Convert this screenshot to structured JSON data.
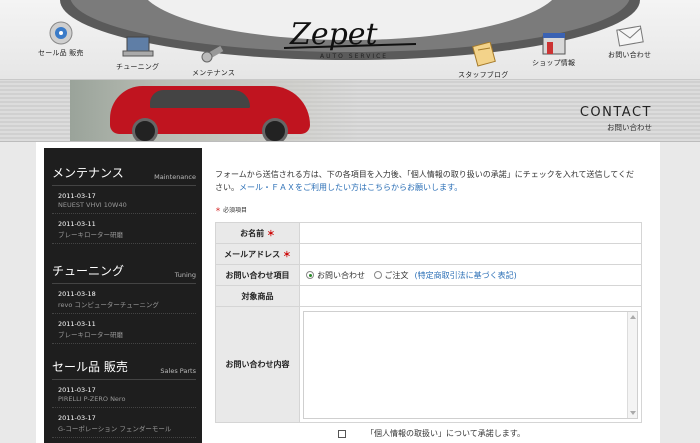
{
  "nav": {
    "sale": "セール品 販売",
    "tuning": "チューニング",
    "maintenance": "メンテナンス",
    "staff_blog": "スタッフブログ",
    "shop_info": "ショップ情報",
    "inquiry": "お問い合わせ"
  },
  "logo": {
    "text": "Zepet",
    "sub": "AUTO SERVICE"
  },
  "banner": {
    "title": "CONTACT",
    "subtitle": "お問い合わせ"
  },
  "sidebar": {
    "maintenance": {
      "title_jp": "メンテナンス",
      "title_en": "Maintenance",
      "posts": [
        {
          "date": "2011-03-17",
          "title": "NEUEST VHVI 10W40"
        },
        {
          "date": "2011-03-11",
          "title": "ブレーキローター研磨"
        }
      ]
    },
    "tuning": {
      "title_jp": "チューニング",
      "title_en": "Tuning",
      "posts": [
        {
          "date": "2011-03-18",
          "title": "revo コンピューターチューニング"
        },
        {
          "date": "2011-03-11",
          "title": "ブレーキローター研磨"
        }
      ]
    },
    "sales": {
      "title_jp": "セール品 販売",
      "title_en": "Sales Parts",
      "posts": [
        {
          "date": "2011-03-17",
          "title": "PIRELLI P-ZERO Nero"
        },
        {
          "date": "2011-03-17",
          "title": "G-コーポレーション フェンダーモール"
        }
      ]
    }
  },
  "content": {
    "intro": "フォームから送信される方は、下の各項目を入力後、「個人情報の取り扱いの承諾」にチェックを入れて送信してください。",
    "intro_link": "メール・ＦＡＸをご利用したい方はこちらからお願いします。",
    "required_star": "＊",
    "required_note": "必須項目"
  },
  "form": {
    "name_label": "お名前",
    "email_label": "メールアドレス",
    "type_label": "お問い合わせ項目",
    "type_options": [
      "お問い合わせ",
      "ご注文"
    ],
    "type_selected": "お問い合わせ",
    "type_note": "(特定商取引法に基づく表記)",
    "product_label": "対象商品",
    "message_label": "お問い合わせ内容",
    "star": "＊",
    "agree_text": "「個人情報の取扱い」について承諾します。"
  },
  "colors": {
    "accent_link": "#2b6fb6",
    "required": "#cc0000",
    "sidebar_bg": "#1e1e1e"
  }
}
